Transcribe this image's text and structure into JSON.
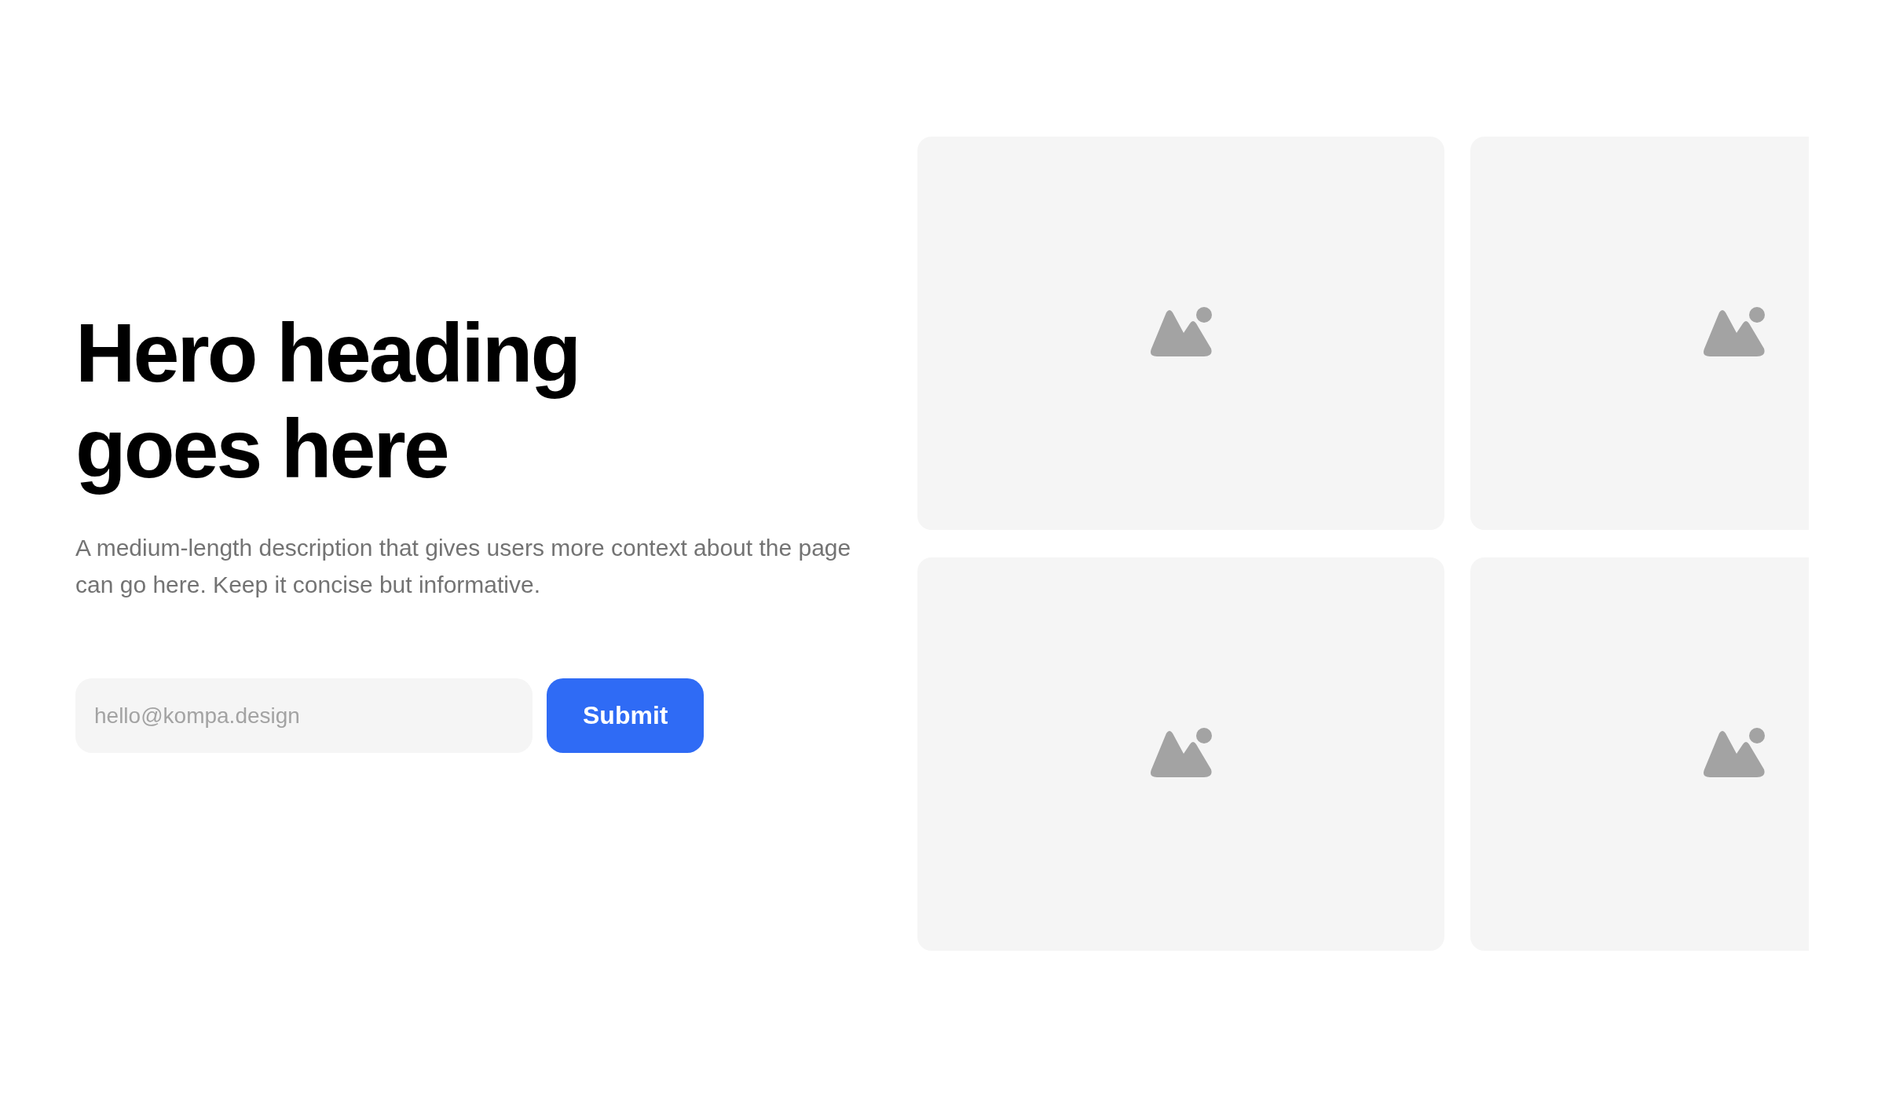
{
  "hero": {
    "heading": "Hero heading goes here",
    "description": "A medium-length description that gives users more context about the page can go here. Keep it concise but informative."
  },
  "form": {
    "email": {
      "placeholder": "hello@kompa.design"
    },
    "submit": "Submit"
  },
  "gallery": [
    {
      "kind": "placeholder"
    },
    {
      "kind": "placeholder"
    },
    {
      "kind": "placeholder"
    },
    {
      "kind": "placeholder"
    }
  ]
}
